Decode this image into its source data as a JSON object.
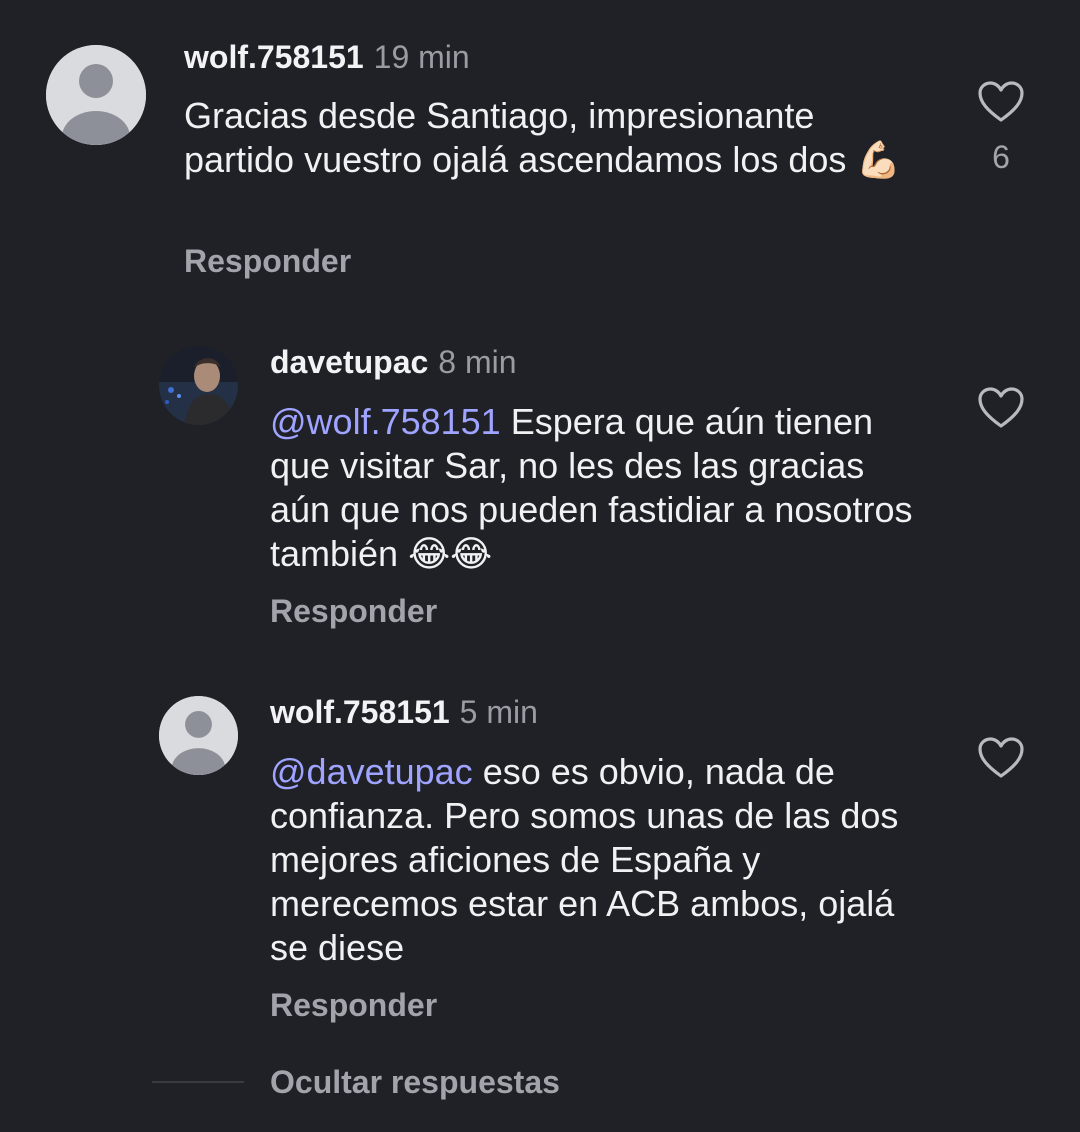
{
  "comments": [
    {
      "username": "wolf.758151",
      "time": "19 min",
      "text": "Gracias desde Santiago, impresionante partido vuestro ojalá ascendamos los dos",
      "emoji": "💪🏻",
      "reply_label": "Responder",
      "like_count": "6",
      "avatar_icon": "default-avatar-icon",
      "like_icon": "heart-outline-icon"
    },
    {
      "username": "davetupac",
      "time": "8 min",
      "mention": "@wolf.758151",
      "text": " Espera que aún tienen que visitar Sar, no les des las gracias aún que nos pueden fastidiar a nosotros también ",
      "emoji": "😂😂",
      "reply_label": "Responder",
      "avatar_icon": "profile-photo-avatar",
      "like_icon": "heart-outline-icon"
    },
    {
      "username": "wolf.758151",
      "time": "5 min",
      "mention": "@davetupac",
      "text": " eso es obvio, nada de confianza. Pero somos unas de las dos mejores aficiones de España y merecemos estar en ACB ambos, ojalá se diese",
      "reply_label": "Responder",
      "avatar_icon": "default-avatar-icon",
      "like_icon": "heart-outline-icon"
    }
  ],
  "hide_replies_label": "Ocultar respuestas",
  "colors": {
    "background": "#202126",
    "mention": "#9ea4ff",
    "secondary_text": "#a3a4ab"
  }
}
